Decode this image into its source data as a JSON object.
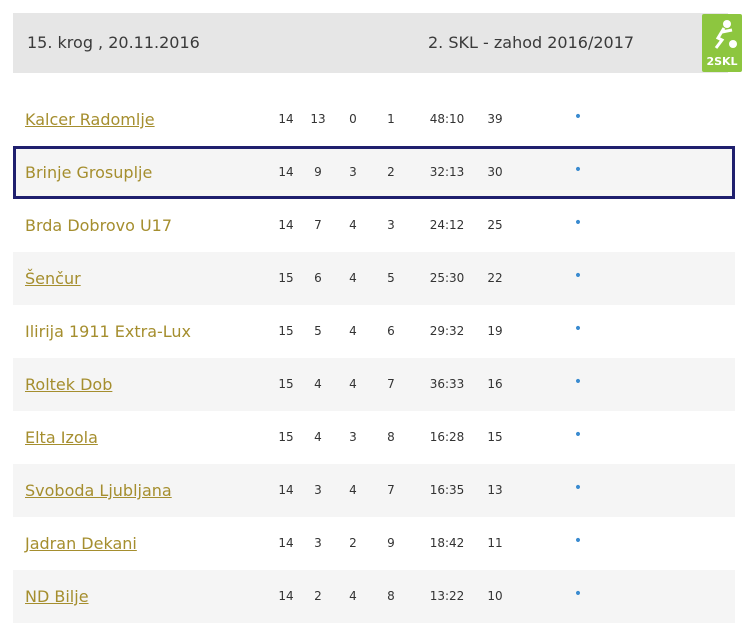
{
  "header": {
    "round": "15. krog , 20.11.2016",
    "league": "2. SKL - zahod 2016/2017",
    "logo_text": "2SKL"
  },
  "colors": {
    "team_text": "#a58e2e",
    "dot": "#3a8bd0",
    "highlight_border": "#1f1f6e",
    "logo_bg": "#8dc63f"
  },
  "table": {
    "rows": [
      {
        "team": "Kalcer Radomlje",
        "played": "14",
        "won": "13",
        "drawn": "0",
        "lost": "1",
        "goals": "48:10",
        "points": "39",
        "marker": "•"
      },
      {
        "team": "Brinje Grosuplje",
        "played": "14",
        "won": "9",
        "drawn": "3",
        "lost": "2",
        "goals": "32:13",
        "points": "30",
        "marker": "•"
      },
      {
        "team": "Brda Dobrovo U17",
        "played": "14",
        "won": "7",
        "drawn": "4",
        "lost": "3",
        "goals": "24:12",
        "points": "25",
        "marker": "•"
      },
      {
        "team": "Šenčur",
        "played": "15",
        "won": "6",
        "drawn": "4",
        "lost": "5",
        "goals": "25:30",
        "points": "22",
        "marker": "•"
      },
      {
        "team": "Ilirija 1911 Extra-Lux",
        "played": "15",
        "won": "5",
        "drawn": "4",
        "lost": "6",
        "goals": "29:32",
        "points": "19",
        "marker": "•"
      },
      {
        "team": "Roltek Dob",
        "played": "15",
        "won": "4",
        "drawn": "4",
        "lost": "7",
        "goals": "36:33",
        "points": "16",
        "marker": "•"
      },
      {
        "team": "Elta Izola",
        "played": "15",
        "won": "4",
        "drawn": "3",
        "lost": "8",
        "goals": "16:28",
        "points": "15",
        "marker": "•"
      },
      {
        "team": "Svoboda Ljubljana",
        "played": "14",
        "won": "3",
        "drawn": "4",
        "lost": "7",
        "goals": "16:35",
        "points": "13",
        "marker": "•"
      },
      {
        "team": "Jadran Dekani",
        "played": "14",
        "won": "3",
        "drawn": "2",
        "lost": "9",
        "goals": "18:42",
        "points": "11",
        "marker": "•"
      },
      {
        "team": "ND Bilje",
        "played": "14",
        "won": "2",
        "drawn": "4",
        "lost": "8",
        "goals": "13:22",
        "points": "10",
        "marker": "•"
      }
    ]
  }
}
